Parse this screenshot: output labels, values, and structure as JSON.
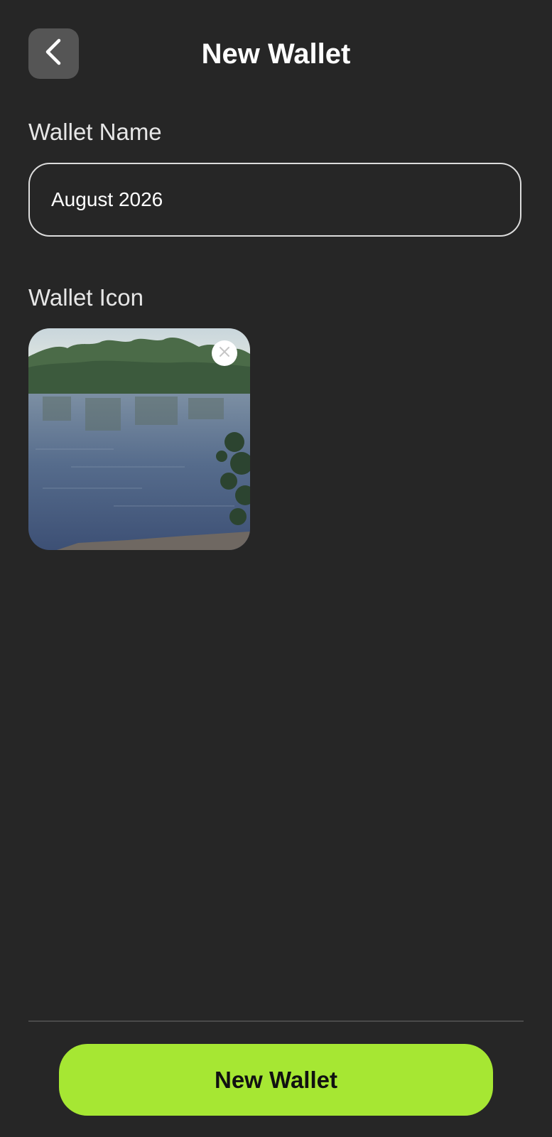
{
  "header": {
    "title": "New Wallet",
    "back_icon": "chevron-left-icon"
  },
  "form": {
    "name_label": "Wallet Name",
    "name_value": "August 2026",
    "icon_label": "Wallet Icon",
    "icon_remove_icon": "close-icon"
  },
  "footer": {
    "submit_label": "New Wallet"
  },
  "colors": {
    "background": "#262626",
    "accent": "#a6e733",
    "back_button": "#555555"
  }
}
